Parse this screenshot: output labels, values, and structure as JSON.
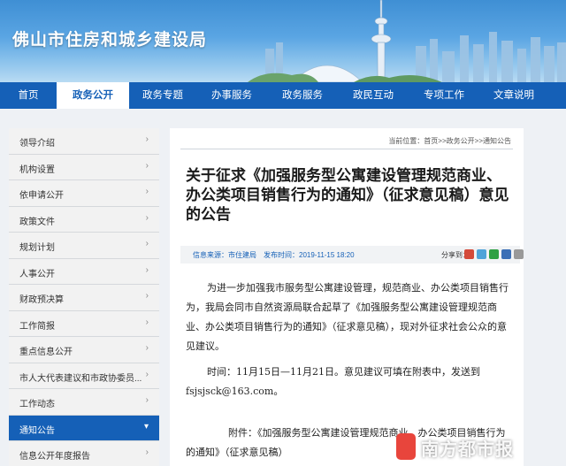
{
  "header": {
    "site_title": "佛山市住房和城乡建设局"
  },
  "nav": {
    "items": [
      "首页",
      "政务公开",
      "政务专题",
      "办事服务",
      "政务服务",
      "政民互动",
      "专项工作",
      "文章说明"
    ],
    "active_index": 1
  },
  "sidebar": {
    "items": [
      {
        "label": "领导介绍"
      },
      {
        "label": "机构设置"
      },
      {
        "label": "依申请公开"
      },
      {
        "label": "政策文件"
      },
      {
        "label": "规划计划"
      },
      {
        "label": "人事公开"
      },
      {
        "label": "财政预决算"
      },
      {
        "label": "工作简报"
      },
      {
        "label": "重点信息公开"
      },
      {
        "label": "市人大代表建议和市政协委员..."
      },
      {
        "label": "工作动态"
      },
      {
        "label": "通知公告"
      },
      {
        "label": "信息公开年度报告"
      }
    ],
    "active_index": 11,
    "arrow_glyph": "›",
    "active_arrow_glyph": "▾"
  },
  "main": {
    "breadcrumb": "当前位置：首页>>政务公开>>通知公告",
    "title": "关于征求《加强服务型公寓建设管理规范商业、办公类项目销售行为的通知》（征求意见稿）意见的公告",
    "meta": {
      "source": "信息来源：市住建局",
      "date": "发布时间：2019-11-15 18:20",
      "share_label": "分享到："
    },
    "paragraphs": [
      "为进一步加强我市服务型公寓建设管理，规范商业、办公类项目销售行为，我局会同市自然资源局联合起草了《加强服务型公寓建设管理规范商业、办公类项目销售行为的通知》（征求意见稿），现对外征求社会公众的意见建议。",
      "时间：11月15日—11月21日。意见建议可填在附表中，发送到fsjsjsck@163.com。",
      "附件：《加强服务型公寓建设管理规范商业、办公类项目销售行为的通知》（征求意见稿）"
    ]
  },
  "watermark": {
    "text": "南方都市报"
  },
  "colors": {
    "nav_bg": "#1560b7",
    "accent": "#1560b7",
    "sidebar_bg": "#f2f2f2"
  }
}
